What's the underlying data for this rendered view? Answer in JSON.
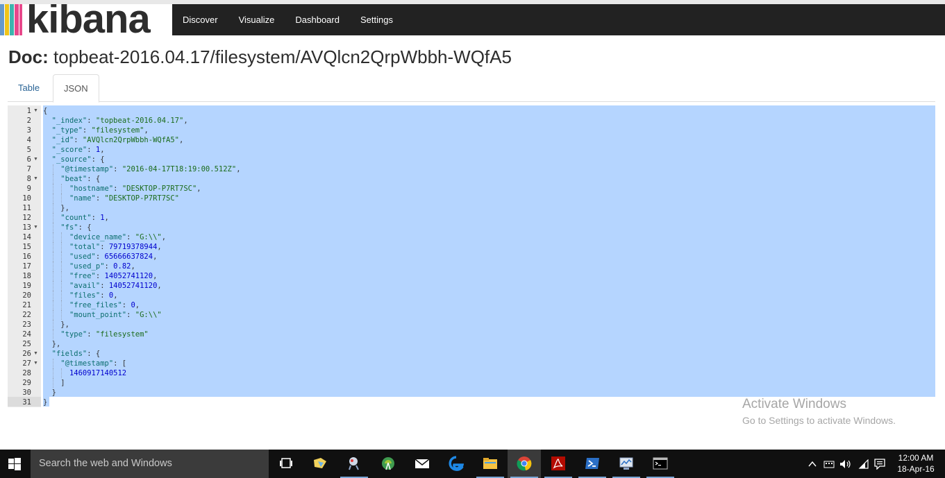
{
  "brand": {
    "name": "kibana",
    "logo_colors": [
      "#e8488b",
      "#3cb5ad",
      "#f0c419",
      "#6699cc"
    ]
  },
  "nav": {
    "items": [
      "Discover",
      "Visualize",
      "Dashboard",
      "Settings"
    ]
  },
  "doc": {
    "label": "Doc:",
    "path": "topbeat-2016.04.17/filesystem/AVQlcn2QrpWbbh-WQfA5"
  },
  "tabs": {
    "table": "Table",
    "json": "JSON",
    "active": "JSON"
  },
  "editor": {
    "line_numbers": [
      "1",
      "2",
      "3",
      "4",
      "5",
      "6",
      "7",
      "8",
      "9",
      "10",
      "11",
      "12",
      "13",
      "14",
      "15",
      "16",
      "17",
      "18",
      "19",
      "20",
      "21",
      "22",
      "23",
      "24",
      "25",
      "26",
      "27",
      "28",
      "29",
      "30",
      "31"
    ],
    "fold_lines": [
      "1",
      "6",
      "8",
      "13",
      "26",
      "27"
    ],
    "lines": [
      "{",
      "  \"_index\": \"topbeat-2016.04.17\",",
      "  \"_type\": \"filesystem\",",
      "  \"_id\": \"AVQlcn2QrpWbbh-WQfA5\",",
      "  \"_score\": 1,",
      "  \"_source\": {",
      "    \"@timestamp\": \"2016-04-17T18:19:00.512Z\",",
      "    \"beat\": {",
      "      \"hostname\": \"DESKTOP-P7RT7SC\",",
      "      \"name\": \"DESKTOP-P7RT7SC\"",
      "    },",
      "    \"count\": 1,",
      "    \"fs\": {",
      "      \"device_name\": \"G:\\\\\",",
      "      \"total\": 79719378944,",
      "      \"used\": 65666637824,",
      "      \"used_p\": 0.82,",
      "      \"free\": 14052741120,",
      "      \"avail\": 14052741120,",
      "      \"files\": 0,",
      "      \"free_files\": 0,",
      "      \"mount_point\": \"G:\\\\\"",
      "    },",
      "    \"type\": \"filesystem\"",
      "  },",
      "  \"fields\": {",
      "    \"@timestamp\": [",
      "      1460917140512",
      "    ]",
      "  }",
      "}"
    ]
  },
  "watermark": {
    "title": "Activate Windows",
    "subtitle": "Go to Settings to activate Windows."
  },
  "taskbar": {
    "search_placeholder": "Search the web and Windows",
    "time": "12:00 AM",
    "date": "18-Apr-16",
    "apps": [
      "task-view",
      "paint",
      "snipping-tool",
      "android-studio",
      "mail",
      "edge",
      "file-explorer",
      "chrome",
      "acrobat",
      "powershell",
      "resource-monitor",
      "command-prompt"
    ]
  }
}
